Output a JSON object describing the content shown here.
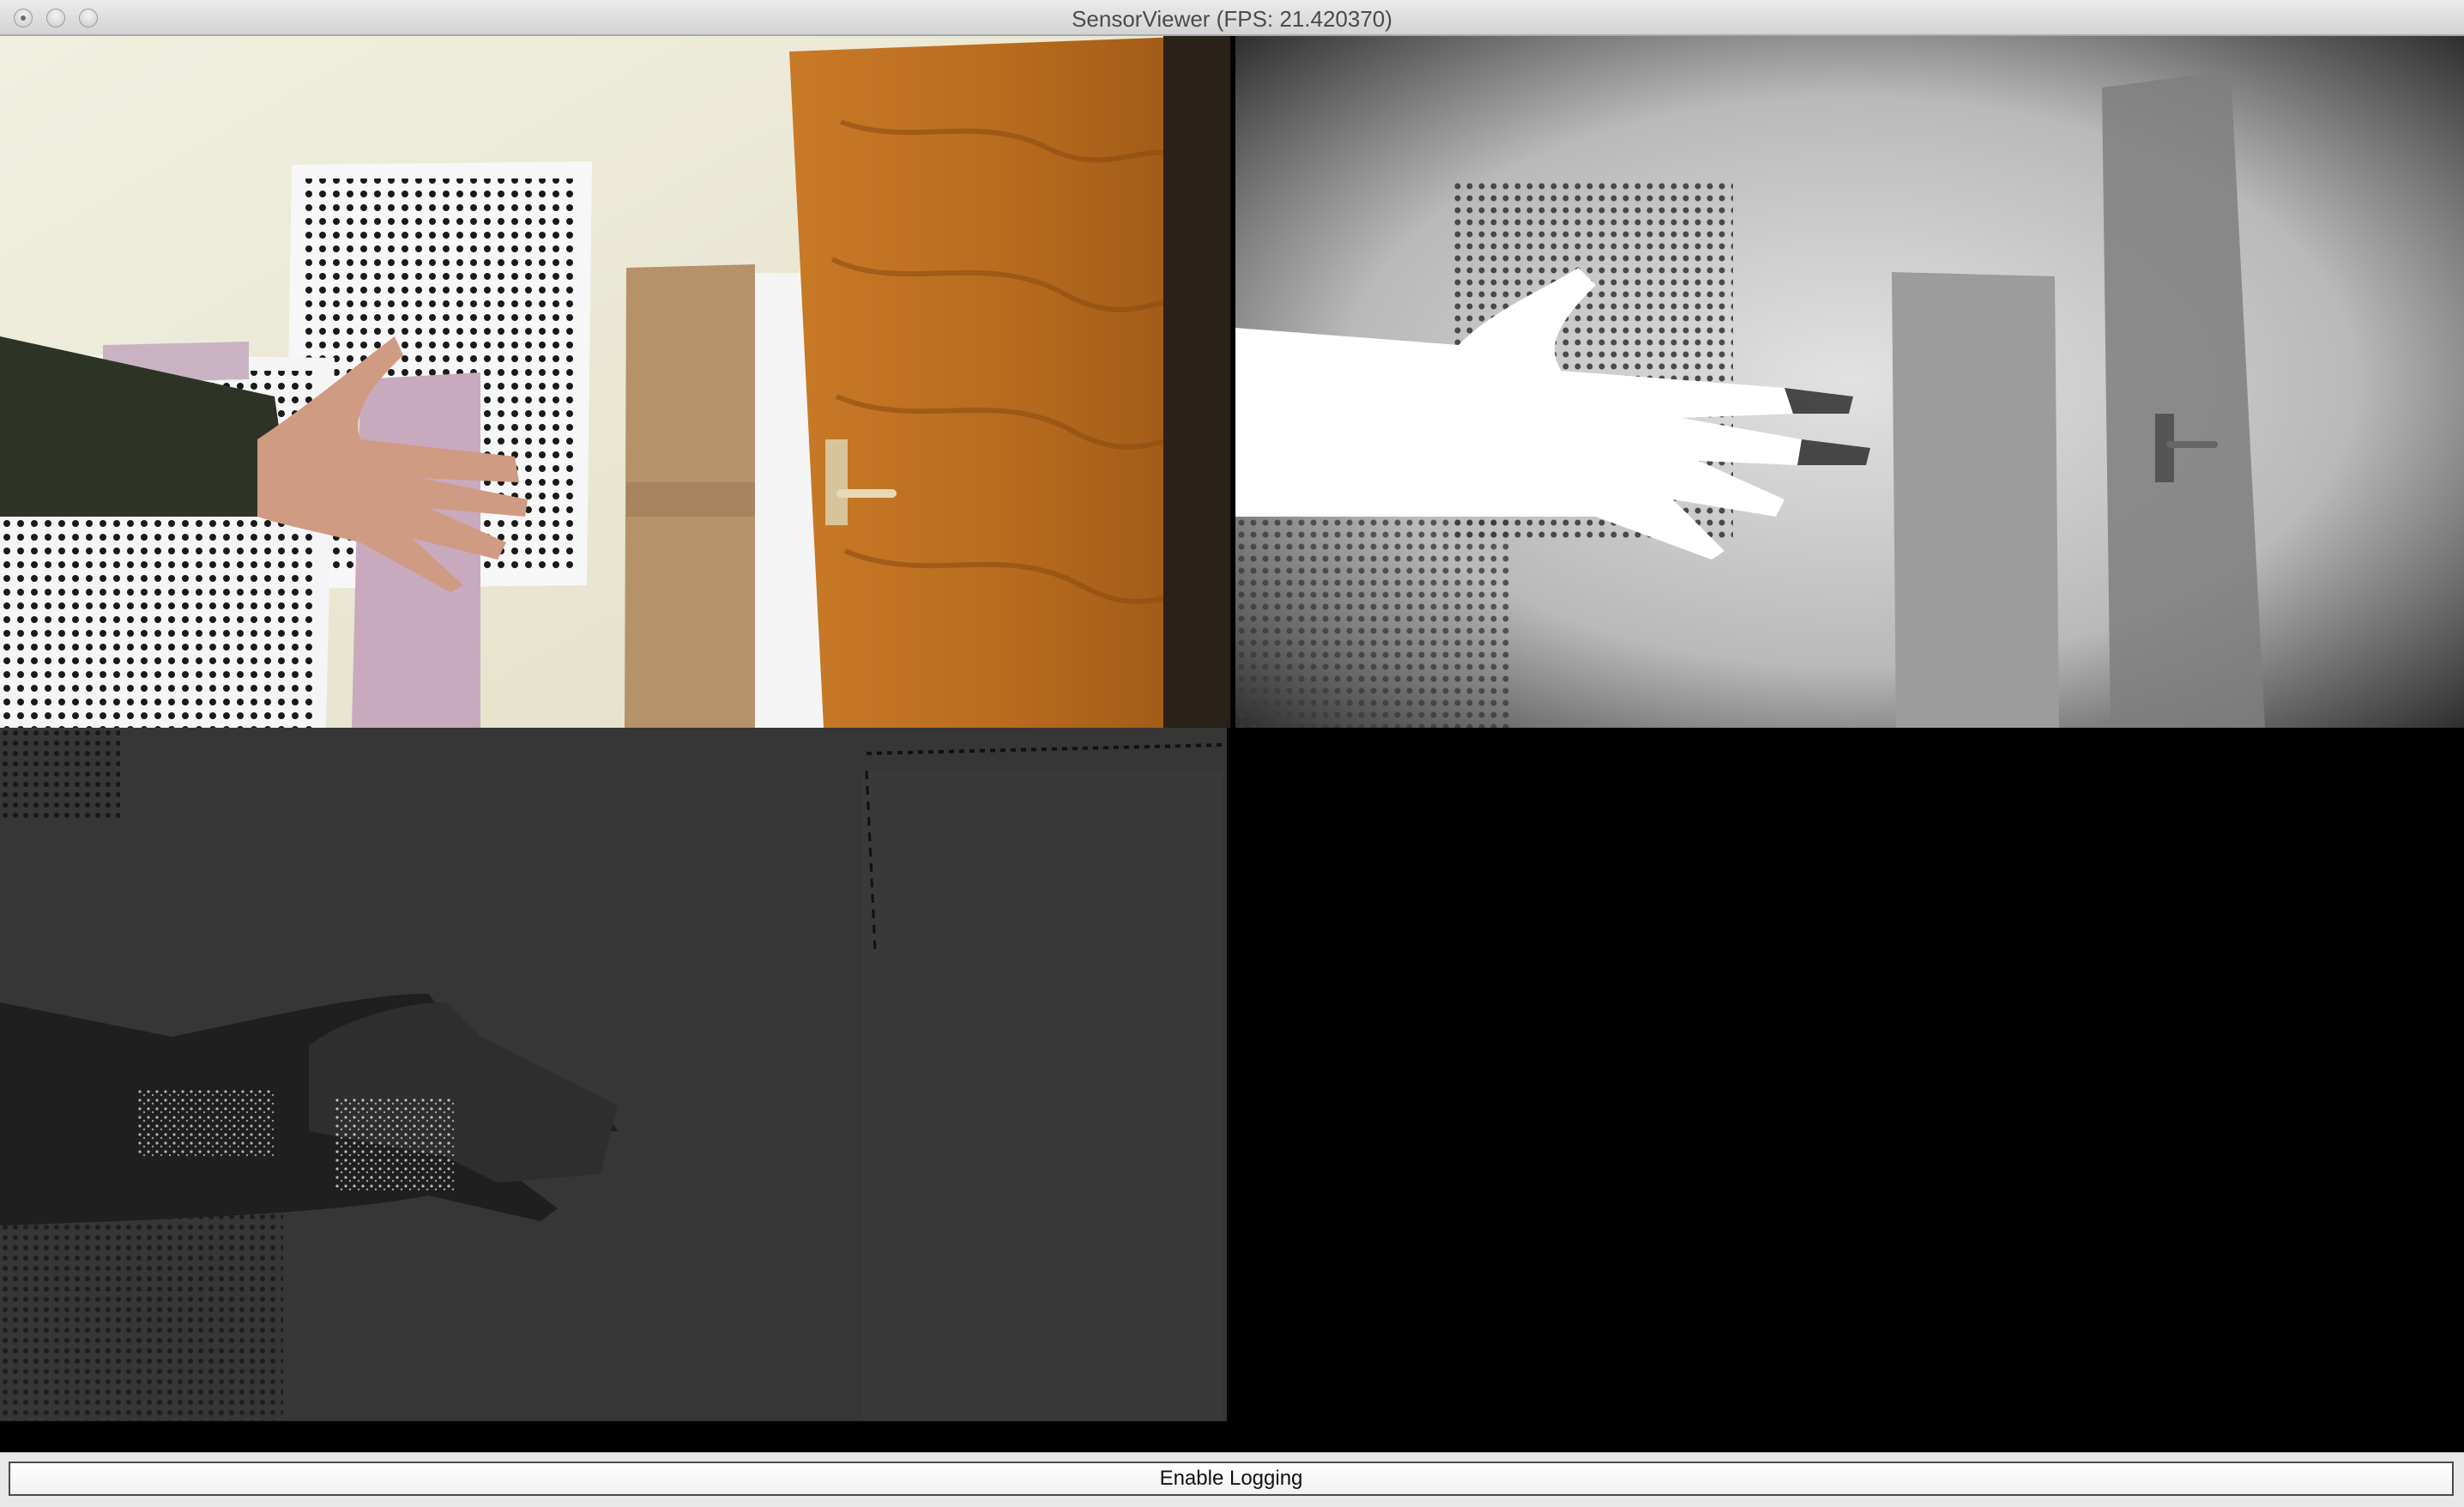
{
  "window": {
    "title": "SensorViewer (FPS: 21.420370)",
    "controls": [
      "close-icon",
      "minimize-icon",
      "zoom-icon"
    ]
  },
  "views": [
    {
      "name": "color-camera-view",
      "content": "photo"
    },
    {
      "name": "infrared-view",
      "content": "grayscale"
    },
    {
      "name": "depth-view",
      "content": "depth map"
    },
    {
      "name": "empty-view",
      "content": "blank"
    }
  ],
  "footer": {
    "logging_button_label": "Enable Logging"
  },
  "colors": {
    "titlebar": "#d8d8d8",
    "door_wood": "#b86b1e",
    "depth_background": "#363636",
    "empty_background": "#000000"
  }
}
